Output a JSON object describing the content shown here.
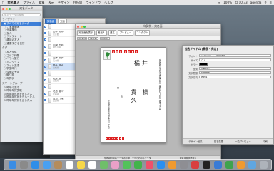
{
  "menubar": {
    "app": "宛名職人",
    "items": [
      "ファイル",
      "編集",
      "表示",
      "デザイン",
      "住所録",
      "ウインドウ",
      "ヘルプ"
    ],
    "battery": "100%",
    "clock": "月 10:33",
    "user": "agenda"
  },
  "main": {
    "title": "宛名データ",
    "search_placeholder": "宛名データの検索",
    "group_library": "ライブラリ",
    "library_items": [
      "すべての宛名データ",
      "ご実家関連",
      "仕事関係",
      "友人",
      "テンプレート",
      "趣味の友人",
      "重要すぎる住所"
    ],
    "group_tags": "タグ",
    "tag_items": [
      "友人全体",
      "ゴルフ仲間",
      "ハワイ旅行",
      "ミニクラブ",
      "ネット友達",
      "学生時代",
      "今後の予定",
      "贈り物",
      "年賀状"
    ],
    "group_smart": "スマートグループ",
    "smart_items": [
      "昨年の喪中",
      "昨年年賀受取",
      "昨年年賀状を出した人",
      "昨年年賀状をもらった人",
      "昨年年賀状を出した人"
    ]
  },
  "list": {
    "tabs": [
      "宛名面",
      "文面"
    ],
    "rows": [
      {
        "name": "",
        "sub": ""
      },
      {
        "name": "田中 太郎",
        "sub": "東京都"
      },
      {
        "name": "",
        "sub": ""
      },
      {
        "name": "川崎 光男",
        "sub": "神奈川県"
      },
      {
        "name": "",
        "sub": ""
      },
      {
        "name": "金澤 栄子",
        "sub": "石川県"
      },
      {
        "name": "橘井 貴久",
        "sub": "宮城県"
      },
      {
        "name": "",
        "sub": ""
      },
      {
        "name": "松井 健",
        "sub": "大阪府"
      },
      {
        "name": "",
        "sub": ""
      },
      {
        "name": "北島 雄介",
        "sub": "北海道"
      },
      {
        "name": "宮島 行雄",
        "sub": "広島県"
      }
    ]
  },
  "editor": {
    "title": "年賀状 - 宛名面",
    "toolbar": [
      "宛名面を表示",
      "差出人",
      "連名",
      "プレビュー",
      "コンタクト"
    ],
    "ruler": {
      "a": "34.2mm",
      "b": "128.1mm",
      "c": "100%"
    },
    "postcard": {
      "zip": [
        "9",
        "8",
        "0",
        "0",
        "8",
        "1",
        "1"
      ],
      "recipient_given": "橘井",
      "recipient_family": "貴久",
      "honorific": "様",
      "address": "宮城県仙台市青葉区一番町四丁目一番十五号",
      "sender_label": "吉",
      "sender_label2": "名",
      "sender_address": "宮城県仙台市若林区荒町二丁目",
      "sender_zip": [
        "9",
        "8",
        "4",
        "0",
        "0",
        "7",
        "5"
      ]
    },
    "status_left": "住所録の宛名データ表示中 - すべての宛名データ",
    "status_right": "1/2 年賀状(5件)"
  },
  "inspector": {
    "title": "宛名アイテム [郵便・宛名]",
    "font_label": "フォント",
    "font_value": "AOENJIS4 #太漢字極細",
    "size_label": "サイズ",
    "size_value": "12.0",
    "color_label": "カラー",
    "layout_label": "配置",
    "layout_value": "均等割付",
    "spacing_label": "文字間隔",
    "spacing_value": "自動調整",
    "mode_label": "文字方向",
    "mode_value": "縦書き",
    "bottom_tabs": [
      "デザイン編集",
      "宛名変更",
      "一覧プレビュー",
      "印刷"
    ]
  },
  "dock": {
    "icons": [
      "finder-icon",
      "launchpad-icon",
      "safari-icon",
      "mail-icon",
      "contacts-icon",
      "calendar-icon",
      "notes-icon",
      "reminders-icon",
      "maps-icon",
      "photos-icon",
      "messages-icon",
      "facetime-icon",
      "music-icon",
      "appstore-icon",
      "books-icon",
      "settings-icon",
      "atena-icon",
      "appleTV-icon",
      "keynote-icon",
      "numbers-icon",
      "pages-icon",
      "folder-icon",
      "trash-icon"
    ],
    "colors": [
      "#3b8de5",
      "#8a8a8a",
      "#2f8ee8",
      "#4aa0f0",
      "#b58c5c",
      "#ffffff",
      "#f7d84a",
      "#ffffff",
      "#6fbe6a",
      "#e9a0c8",
      "#52c25a",
      "#42b34a",
      "#f0506a",
      "#2a8ff0",
      "#f09a30",
      "#8e8e93",
      "#d94040",
      "#222222",
      "#3a7bd5",
      "#3fa34d",
      "#f09a30",
      "#5aa7e8",
      "#b0b6bc"
    ]
  }
}
